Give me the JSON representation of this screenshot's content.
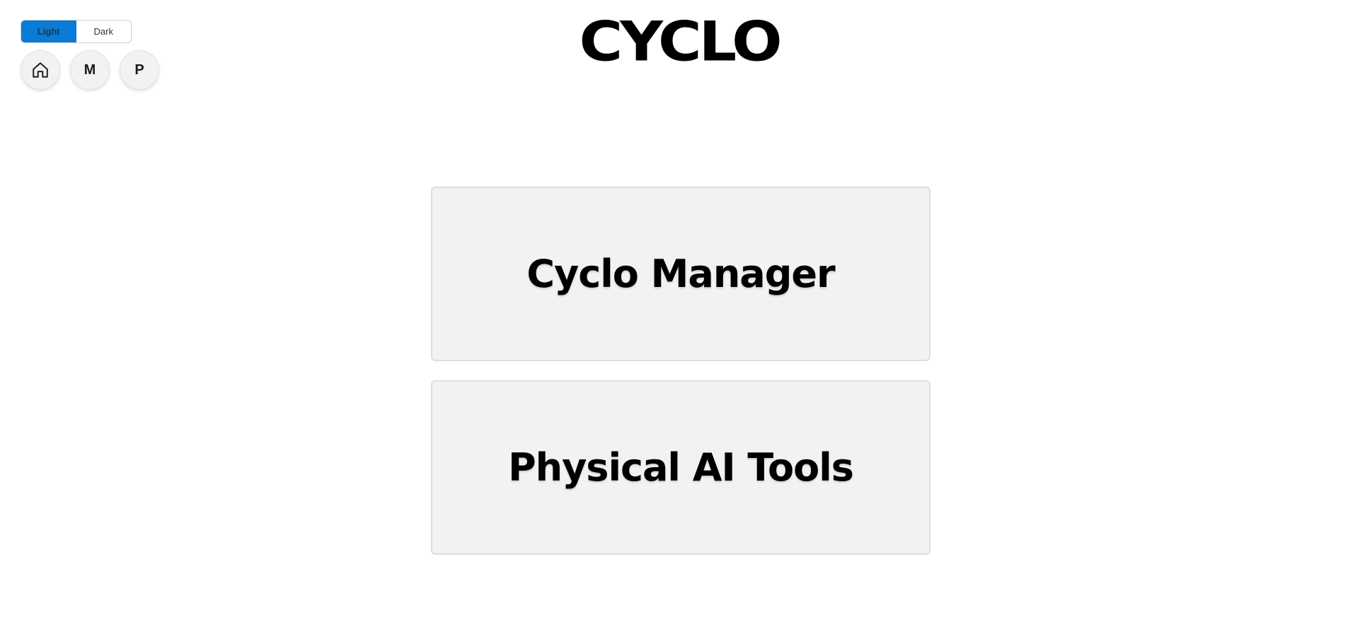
{
  "theme": {
    "options": [
      {
        "label": "Light",
        "active": true
      },
      {
        "label": "Dark",
        "active": false
      }
    ],
    "accent_color": "#0a7bd6"
  },
  "nav": {
    "home_icon": "home-icon",
    "buttons": [
      {
        "label": "M"
      },
      {
        "label": "P"
      }
    ]
  },
  "logo": {
    "text": "CYCLO"
  },
  "cards": [
    {
      "title": "Cyclo Manager"
    },
    {
      "title": "Physical AI Tools"
    }
  ],
  "colors": {
    "background": "#ffffff",
    "card_background": "#f2f2f2",
    "card_border": "#dedede",
    "text": "#000000"
  }
}
